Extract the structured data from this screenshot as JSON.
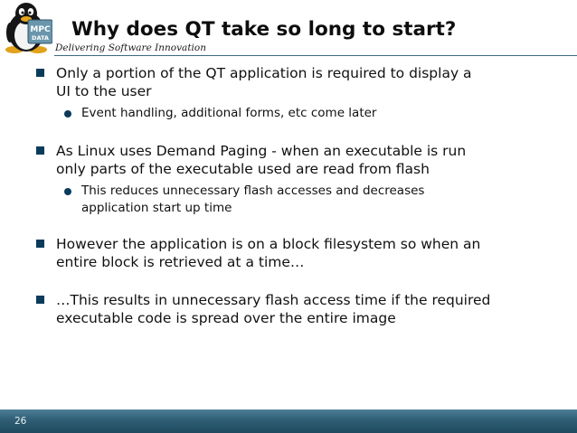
{
  "header": {
    "logo_text": [
      "MPC",
      "DATA"
    ],
    "title": "Why does QT take so long to start?",
    "tagline": "Delivering Software Innovation"
  },
  "bullets": [
    {
      "text_lines": [
        "Only a portion of the QT application is required to display a",
        "UI to the user"
      ],
      "sub": [
        {
          "text_lines": [
            "Event handling, additional forms, etc come later"
          ]
        }
      ]
    },
    {
      "text_lines": [
        "As Linux uses Demand Paging - when an executable is run",
        "only parts of the executable used are read from flash"
      ],
      "sub": [
        {
          "text_lines": [
            "This reduces unnecessary flash accesses and decreases",
            "application start up time"
          ]
        }
      ]
    },
    {
      "text_lines": [
        "However the application is on a block filesystem so when an",
        "entire block is retrieved at a time…"
      ],
      "sub": []
    },
    {
      "text_lines": [
        "…This results in unnecessary flash access time if the required",
        "executable code is spread over the entire image"
      ],
      "sub": []
    }
  ],
  "footer": {
    "page_number": "26"
  },
  "colors": {
    "bullet": "#0b3b5b",
    "footer_bar": "#2f5e74",
    "rule": "#3b6a82"
  },
  "icons": {
    "logo": "tux-penguin-logo",
    "level1_bullet": "square-bullet",
    "level2_bullet": "round-bullet"
  }
}
